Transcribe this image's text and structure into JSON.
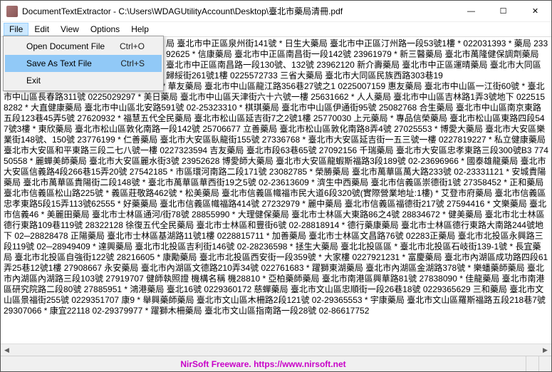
{
  "window": {
    "title": "DocumentTextExtractor - C:\\Users\\WDAGUtilityAccount\\Desktop\\臺北市藥局清冊.pdf"
  },
  "winbtns": {
    "min": "—",
    "max": "☐",
    "close": "✕"
  },
  "menu": {
    "file": "File",
    "edit": "Edit",
    "view": "View",
    "options": "Options",
    "help": "Help"
  },
  "file_menu": {
    "open": "Open Document File",
    "open_key": "Ctrl+O",
    "save": "Save As Text File",
    "save_key": "Ctrl+S",
    "exit": "Exit"
  },
  "body_text": "榮昌藥局 臺北市中山區雙城街十七之三號 * 華友藥局 臺北市中山區龍江路356巷27號之1 0225007159 惠友藥局 臺北市中山區一江街60號 * 臺北市中山區長春路311號 0225029297 * 美日藥局 臺北市中山區天津街六十六號一樓 25631662 * 人人藥局 臺北市中山區吉林路1弄3號地下 0225158282 * 大直健康藥局 臺北市中山區北安路591號 02-25323310 * 棋琪藥局 臺北市中山區伊通街95號 25082768 合生藥局 臺北市中山區南京東路五段123巷45弄5號 27620932 * 福慧五代全民藥局 臺北市松山區延吉街7之2號1樓 25770030 上元藥局 * 專品信榮藥局 臺北市松山區東路四段547號3樓 * 東欣藥局 臺北市松山區敦化南路一段142號 25706677 立善藥局 臺北市松山區敦化南路8弄4號 27025553 * 博愛大藥局 臺北市大安區樂業街148號、150號 23776199 * 仁善藥局 臺北市大安區臥龍街155號 27336768 * 臺北市大安區延吉街一五三號一樓 0227819227 * 私立健康藥局 臺北市大安區和平東路三段二七八號一樓 0227323594 吉友藥局 臺北市段63巷65號 27092156 千瑞藥局 臺北市大安區忠孝東路三段300號B3 77450558 * 麗蟬美師藥局 臺北市大安區麗水街3號 23952628 博愛師大藥局 臺北市大安區龍蝦斯福路3段189號 02-23696966 * 國泰雄龍藥局 臺北市大安區信義路4段266巷15弄20號 27542185 * 市區環河南路二段171號 23082785 * 榮勝藥局 臺北市萬華區萬大路233號 02-23331121 * 安城貴陽藥局 臺北市萬華區貴陽街二段148號 * 臺北市萬華區華西街19之5號 02-23613609 * 濟生中西藥局 臺北市信義區崇德街1號 27358452 * 正和藥局 臺北市信義區松山路225號 * 義區莊敬路462號 * 松美藥局 臺北市信義區幟福市民大道6段320號(實際營業地址:1樓) * 艾登市府藥局 臺北市信義區忠孝東路5段15弄113號62555 * 好藥藥局 臺北市信義區幟福路414號 27232979 * 麗中藥局 臺北市信義區福德街217號 27594416 * 文樂藥局 臺北市信義46 * 美麗田藥局 臺北市士林區通河/街78號 28855990 * 大理健保藥局 臺北市士林區大東路86之4號 28834672 * 健美藥局 臺北市北士林區德行東路109巷119號 28322128 徐復五代全民藥局 臺北市士林區和豐街6號 02-28818914 * 德行藥康藥局 臺北市士林區德行東路大南路244號地下 02─28828478 正陽藥局 臺北市士林區基湖路11號1樓 0228815711 * 加善藥局 臺北市士林區文昌路76號 02283正藥局 臺北市北投區永興路三段119號 02─28949409 * 達興藥局 臺北市北投區吉利街146號 02-28236598 * 拯生大藥局 臺北北投區區 * 臺北市北投區石岐街139-1號 * 長宜藥局 臺北市北投區自強街122號 28216605 * 康勵藥局 臺北市北投區西安街一段359號 * 大家樓 0227921231 * 富慶藥局 臺北市內湖區成功路四段61弄25巷12號1樓 27908667 永安藥局 臺北市內湖區文德路210弄34號 022761683 * 躍獅東湖藥局 臺北市內湖區金湖路378號 * 樂蟠藥師藥局 臺北市內湖區內湖路三段103號 27919707 健師執照證 機構名稱 機28810 * 亞柏藥師藥局 臺北市南港區興華路81號 27838090 * 佳龍藥局 臺北市南港區研究院路二段80號 27885951 * 鴻港藥局 臺北16號 0229360172 慈蟬藥局 臺北市文山區忠順街一段26巷18號 0229365629 三和藥局 臺北市文山區景福街255號 0229351707 康9 * 舉興藥師藥局 臺北市文山區木柵路2段121號 02-29365553 * 宇康藥局 臺北市文山區羅斯福路五段218巷7號 29307066 * 康宜22118 02-29379977 * 躍獅木柵藥局 臺北市文山區指南路一段28號 02-86617752",
  "body_prefix": "局 臺北市中正區泉州街141號 * 日生大藥局 臺北市中正區汀州路一段53號1樓 * 022031393 * 藥局 23392625 * 信康藥局 臺北市中正區南昌街一段142號 23961979 * 新三醫藥局 臺北市萬隆健保調劑藥局 臺北市中正區南昌路一段130號、132號 23962120 新介壽藥局 臺北市中正區運晴藥局 臺北市大同區歸綏街261號1樓 0225572733 三省大藥局 臺北市大同區民族西路303巷19",
  "scroll": {
    "left": "◀",
    "right": "▶"
  },
  "status": {
    "text": "NirSoft Freeware. https://www.nirsoft.net"
  }
}
